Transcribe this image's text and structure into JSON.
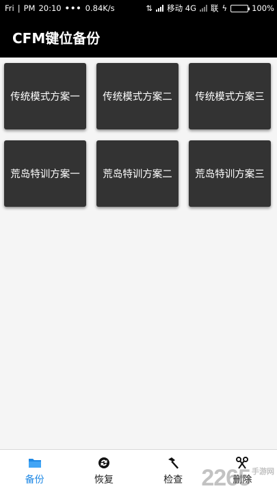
{
  "status_bar": {
    "day": "Fri",
    "period": "PM",
    "time": "20:10",
    "speed": "0.84K/s",
    "carrier": "移动 4G",
    "carrier2": "联",
    "battery_percent": "100%",
    "battery_level": 1.0,
    "battery_color": "#e07ad6"
  },
  "app_bar": {
    "title": "CFM键位备份"
  },
  "tiles": [
    {
      "label": "传统模式方案一"
    },
    {
      "label": "传统模式方案二"
    },
    {
      "label": "传统模式方案三"
    },
    {
      "label": "荒岛特训方案一"
    },
    {
      "label": "荒岛特训方案二"
    },
    {
      "label": "荒岛特训方案三"
    }
  ],
  "bottom_nav": {
    "items": [
      {
        "label": "备份",
        "icon": "folder-icon",
        "active": true
      },
      {
        "label": "恢复",
        "icon": "restore-icon",
        "active": false
      },
      {
        "label": "检查",
        "icon": "hammer-icon",
        "active": false
      },
      {
        "label": "删除",
        "icon": "scissors-icon",
        "active": false
      }
    ],
    "active_color": "#1e88e5"
  },
  "watermark": {
    "number": "2265",
    "text": "手游网"
  }
}
